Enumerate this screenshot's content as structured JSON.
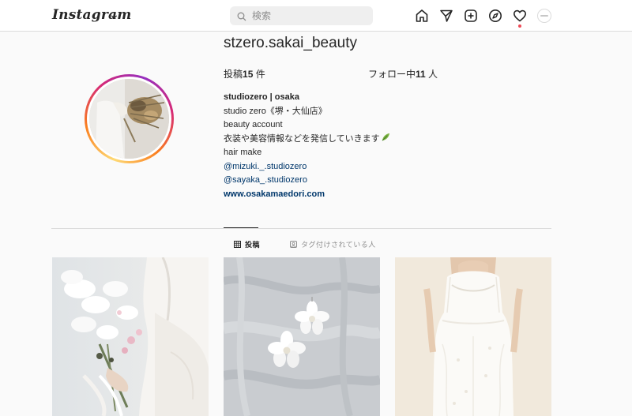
{
  "nav": {
    "logo": "Instagram",
    "search_placeholder": "検索",
    "icons": [
      "home-icon",
      "direct-icon",
      "new-post-icon",
      "explore-icon",
      "activity-icon",
      "profile-avatar"
    ]
  },
  "profile": {
    "username": "stzero.sakai_beauty",
    "posts_label": "投稿",
    "posts_count": "15",
    "posts_unit": " 件",
    "following_label": "フォロー中",
    "following_count": "11",
    "following_unit": " 人",
    "bio": {
      "name": "studiozero | osaka",
      "line1": "studio zero《堺・大仙店》",
      "line2": "beauty account",
      "line3": "衣装や美容情報などを発信していきます",
      "line4": "hair make",
      "mention1": "@mizuki._.studiozero",
      "mention2": "@sayaka_.studiozero",
      "website": "www.osakamaedori.com"
    }
  },
  "tabs": {
    "posts": "投稿",
    "tagged": "タグ付けされている人"
  },
  "grid": [
    {
      "subject": "bridal-bouquet-photo"
    },
    {
      "subject": "flower-earrings-photo"
    },
    {
      "subject": "wedding-dress-photo"
    }
  ],
  "colors": {
    "link": "#00376b",
    "notification": "#ed4956",
    "border": "#dbdbdb",
    "background": "#fafafa"
  }
}
